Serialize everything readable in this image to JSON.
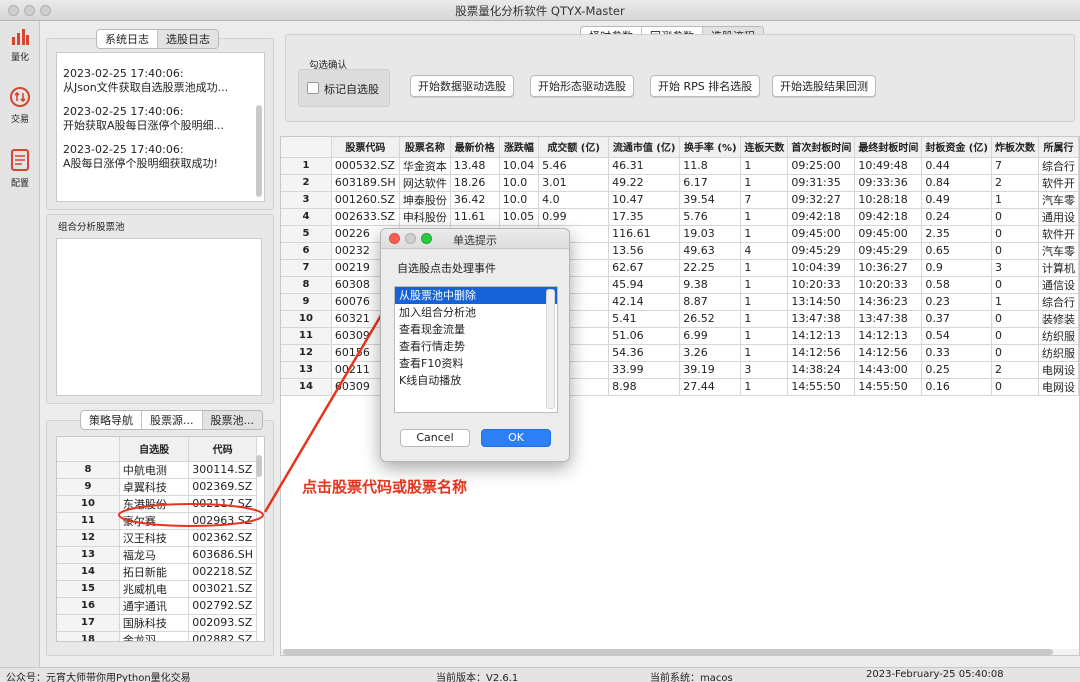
{
  "window": {
    "title": "股票量化分析软件 QTYX-Master"
  },
  "leftbar": [
    {
      "icon": "bar-chart-icon",
      "label": "量化"
    },
    {
      "icon": "trade-arrows-icon",
      "label": "交易"
    },
    {
      "icon": "document-icon",
      "label": "配置"
    }
  ],
  "log_tabs": [
    "系统日志",
    "选股日志"
  ],
  "log_entries": [
    {
      "time": "2023-02-25 17:40:06:",
      "msg": "从Json文件获取自选股票池成功..."
    },
    {
      "time": "2023-02-25 17:40:06:",
      "msg": "开始获取A股每日涨停个股明细..."
    },
    {
      "time": "2023-02-25 17:40:06:",
      "msg": "A股每日涨停个股明细获取成功!"
    }
  ],
  "group_pool_label": "组合分析股票池",
  "top_tabs": [
    "择时参数",
    "回测参数",
    "选股流程"
  ],
  "confirm": {
    "label": "勾选确认",
    "checkbox": "标记自选股"
  },
  "actions": [
    "开始数据驱动选股",
    "开始形态驱动选股",
    "开始 RPS 排名选股",
    "开始选股结果回测"
  ],
  "grid": {
    "columns": [
      "股票代码",
      "股票名称",
      "最新价格",
      "涨跌幅",
      "成交额 (亿)",
      "流通市值 (亿)",
      "换手率 (%)",
      "连板天数",
      "首次封板时间",
      "最终封板时间",
      "封板资金 (亿)",
      "炸板次数",
      "所属行"
    ],
    "rows": [
      [
        "1",
        "000532.SZ",
        "华金资本",
        "13.48",
        "10.04",
        "5.46",
        "46.31",
        "11.8",
        "1",
        "09:25:00",
        "10:49:48",
        "0.44",
        "7",
        "综合行"
      ],
      [
        "2",
        "603189.SH",
        "网达软件",
        "18.26",
        "10.0",
        "3.01",
        "49.22",
        "6.17",
        "1",
        "09:31:35",
        "09:33:36",
        "0.84",
        "2",
        "软件开"
      ],
      [
        "3",
        "001260.SZ",
        "坤泰股份",
        "36.42",
        "10.0",
        "4.0",
        "10.47",
        "39.54",
        "7",
        "09:32:27",
        "10:28:18",
        "0.49",
        "1",
        "汽车零"
      ],
      [
        "4",
        "002633.SZ",
        "申科股份",
        "11.61",
        "10.05",
        "0.99",
        "17.35",
        "5.76",
        "1",
        "09:42:18",
        "09:42:18",
        "0.24",
        "0",
        "通用设"
      ],
      [
        "5",
        "00226",
        "",
        "",
        "",
        ".69",
        "116.61",
        "19.03",
        "1",
        "09:45:00",
        "09:45:00",
        "2.35",
        "0",
        "软件开"
      ],
      [
        "6",
        "00232",
        "",
        "",
        "",
        "45",
        "13.56",
        "49.63",
        "4",
        "09:45:29",
        "09:45:29",
        "0.65",
        "0",
        "汽车零"
      ],
      [
        "7",
        "00219",
        "",
        "",
        "",
        ".74",
        "62.67",
        "22.25",
        "1",
        "10:04:39",
        "10:36:27",
        "0.9",
        "3",
        "计算机"
      ],
      [
        "8",
        "60308",
        "",
        "",
        "",
        "19",
        "45.94",
        "9.38",
        "1",
        "10:20:33",
        "10:20:33",
        "0.58",
        "0",
        "通信设"
      ],
      [
        "9",
        "60076",
        "",
        "",
        "",
        "65",
        "42.14",
        "8.87",
        "1",
        "13:14:50",
        "14:36:23",
        "0.23",
        "1",
        "综合行"
      ],
      [
        "10",
        "60321",
        "",
        "",
        "",
        "38",
        "5.41",
        "26.52",
        "1",
        "13:47:38",
        "13:47:38",
        "0.37",
        "0",
        "装修装"
      ],
      [
        "11",
        "60309",
        "",
        "",
        "",
        "43",
        "51.06",
        "6.99",
        "1",
        "14:12:13",
        "14:12:13",
        "0.54",
        "0",
        "纺织服"
      ],
      [
        "12",
        "60156",
        "",
        "",
        "",
        "7",
        "54.36",
        "3.26",
        "1",
        "14:12:56",
        "14:12:56",
        "0.33",
        "0",
        "纺织服"
      ],
      [
        "13",
        "00211",
        "",
        "",
        "",
        ".47",
        "33.99",
        "39.19",
        "3",
        "14:38:24",
        "14:43:00",
        "0.25",
        "2",
        "电网设"
      ],
      [
        "14",
        "60309",
        "",
        "",
        "",
        "35",
        "8.98",
        "27.44",
        "1",
        "14:55:50",
        "14:55:50",
        "0.16",
        "0",
        "电网设"
      ]
    ]
  },
  "pool_tabs": [
    "策略导航",
    "股票源...",
    "股票池..."
  ],
  "pool": {
    "columns": [
      "自选股",
      "代码"
    ],
    "rows": [
      [
        "8",
        "中航电测",
        "300114.SZ"
      ],
      [
        "9",
        "卓翼科技",
        "002369.SZ"
      ],
      [
        "10",
        "东港股份",
        "002117.SZ"
      ],
      [
        "11",
        "豪尔赛",
        "002963.SZ"
      ],
      [
        "12",
        "汉王科技",
        "002362.SZ"
      ],
      [
        "13",
        "福龙马",
        "603686.SH"
      ],
      [
        "14",
        "拓日新能",
        "002218.SZ"
      ],
      [
        "15",
        "兆威机电",
        "003021.SZ"
      ],
      [
        "16",
        "通宇通讯",
        "002792.SZ"
      ],
      [
        "17",
        "国脉科技",
        "002093.SZ"
      ],
      [
        "18",
        "金龙羽",
        "002882.SZ"
      ],
      [
        "19",
        "",
        ""
      ]
    ]
  },
  "dialog": {
    "title": "单选提示",
    "prompt": "自选股点击处理事件",
    "options": [
      "从股票池中删除",
      "加入组合分析池",
      "查看现金流量",
      "查看行情走势",
      "查看F10资料",
      "K线自动播放"
    ],
    "cancel": "Cancel",
    "ok": "OK"
  },
  "annotation": {
    "text": "点击股票代码或股票名称",
    "color": "#e8341c"
  },
  "status": {
    "left": "公众号：元宵大师带你用Python量化交易",
    "version": "当前版本：V2.6.1",
    "system": "当前系统：macos",
    "datetime": "2023-February-25 05:40:08"
  }
}
